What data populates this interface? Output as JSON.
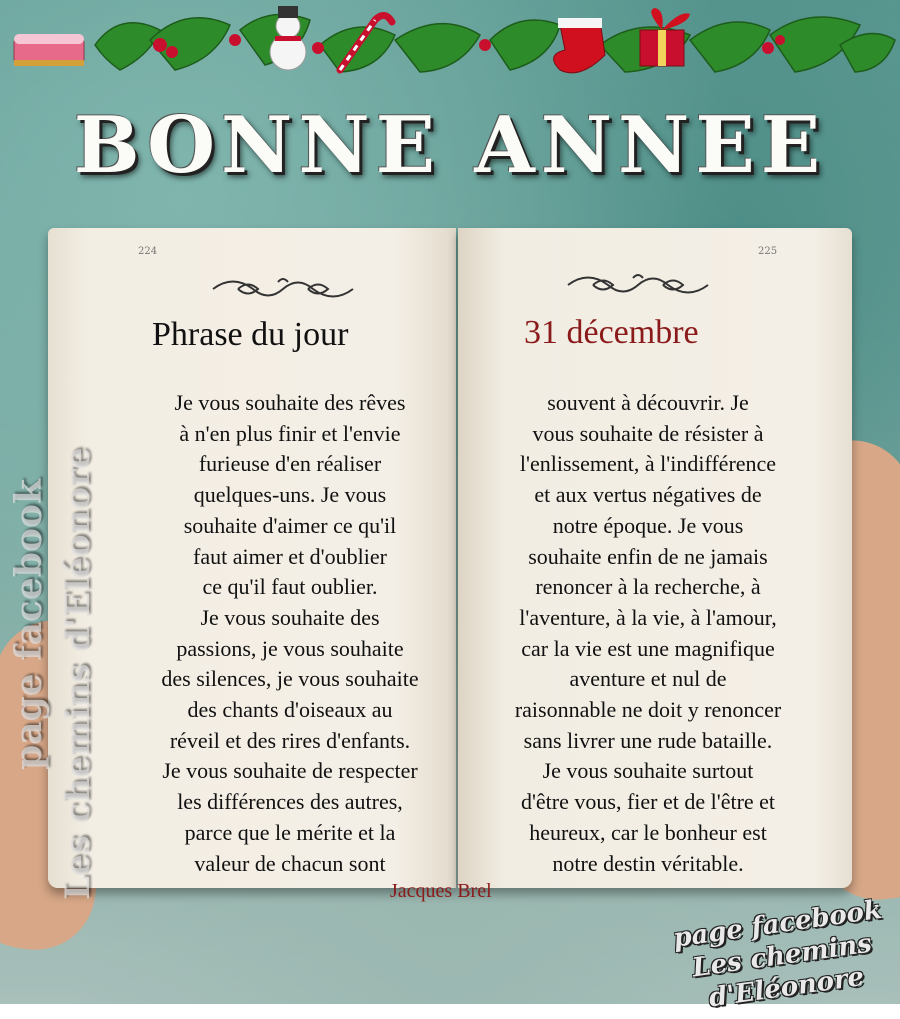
{
  "title": "BONNE ANNEE",
  "book": {
    "left_page_number": "224",
    "right_page_number": "225",
    "heading_left": "Phrase du jour",
    "heading_right": "31 décembre",
    "heading_right_color": "#8b1b1b",
    "left_lines": [
      "Je vous souhaite des rêves",
      "à n'en plus finir et l'envie",
      "furieuse d'en réaliser",
      "quelques-uns. Je vous",
      "souhaite d'aimer ce qu'il",
      "faut aimer et d'oublier",
      "ce qu'il faut oublier.",
      "Je vous souhaite des",
      "passions, je vous souhaite",
      "des silences, je vous souhaite",
      "des chants d'oiseaux au",
      "réveil et des rires d'enfants.",
      "Je vous souhaite de respecter",
      "les différences des autres,",
      "parce que le mérite et la",
      "valeur de chacun sont"
    ],
    "right_lines": [
      "souvent à découvrir. Je",
      "vous souhaite de résister à",
      "l'enlissement, à l'indifférence",
      "et aux vertus négatives de",
      "notre époque. Je vous",
      "souhaite enfin de ne jamais",
      "renoncer à la recherche, à",
      "l'aventure, à la vie, à l'amour,",
      "car la vie est une magnifique",
      "aventure et nul de",
      "raisonnable ne doit y renoncer",
      "sans livrer une rude bataille.",
      "Je vous souhaite surtout",
      "d'être vous, fier et de l'être et",
      "heureux, car le bonheur est",
      "notre destin véritable."
    ],
    "author": "Jacques Brel"
  },
  "watermark_vertical": {
    "line1": "page facebook",
    "line2": "Les chemins d'Eléonore"
  },
  "watermark_corner": {
    "line1": "page facebook",
    "line2": "Les chemins",
    "line3": "d'Eléonore"
  },
  "decorations": [
    "cake-icon",
    "holly-icon",
    "snowman-icon",
    "candy-cane-icon",
    "stocking-icon",
    "gift-icon"
  ]
}
